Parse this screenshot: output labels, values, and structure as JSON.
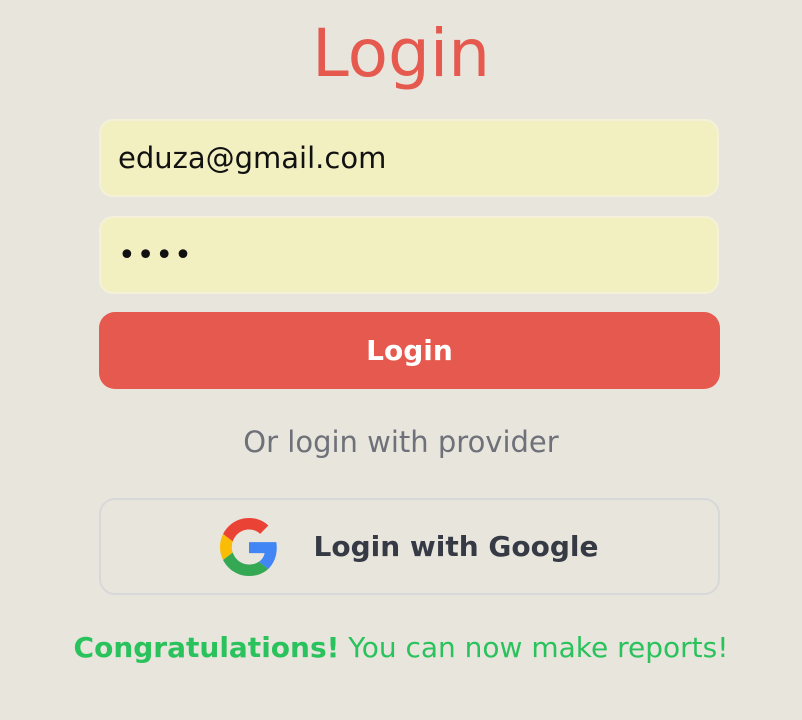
{
  "page": {
    "title": "Login"
  },
  "form": {
    "email_value": "eduza@gmail.com",
    "password_value": "••••",
    "login_label": "Login",
    "divider_text": "Or login with provider",
    "google_label": "Login with Google"
  },
  "icons": {
    "google": "google-logo-icon"
  },
  "message": {
    "bold": "Congratulations!",
    "text": " You can now make reports!"
  },
  "colors": {
    "background": "#e8e5dc",
    "accent": "#e5594f",
    "input_fill": "#f2efc0",
    "success": "#2ac25c",
    "muted": "#6e7179"
  }
}
